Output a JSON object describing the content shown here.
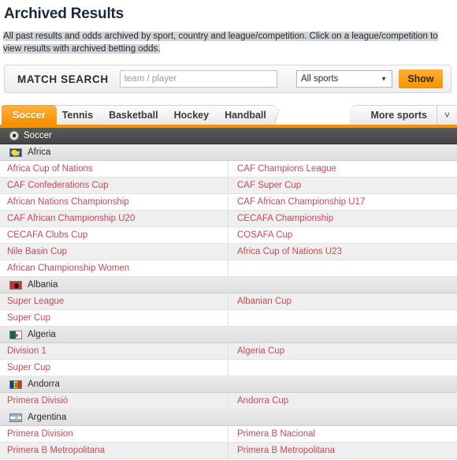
{
  "page": {
    "title": "Archived Results",
    "description": "All past results and odds archived by sport, country and league/competition. Click on a league/competition to view results with archived betting odds."
  },
  "search": {
    "label": "MATCH SEARCH",
    "input_value": "",
    "input_placeholder": "team / player",
    "sport_selected": "All sports",
    "show_label": "Show"
  },
  "tabs": {
    "items": [
      {
        "label": "Soccer",
        "active": true
      },
      {
        "label": "Tennis",
        "active": false
      },
      {
        "label": "Basketball",
        "active": false
      },
      {
        "label": "Hockey",
        "active": false
      },
      {
        "label": "Handball",
        "active": false
      }
    ],
    "more_label": "More sports",
    "more_caret": "⌄"
  },
  "sport_header": {
    "label": "Soccer"
  },
  "countries": [
    {
      "name": "Africa",
      "flag": "flag-africa",
      "leagues": [
        [
          "Africa Cup of Nations",
          "CAF Champions League"
        ],
        [
          "CAF Confederations Cup",
          "CAF Super Cup"
        ],
        [
          "African Nations Championship",
          "CAF African Championship U17"
        ],
        [
          "CAF African Championship U20",
          "CECAFA Championship"
        ],
        [
          "CECAFA Clubs Cup",
          "COSAFA Cup"
        ],
        [
          "Nile Basin Cup",
          "Africa Cup of Nations U23"
        ],
        [
          "African Championship Women",
          ""
        ]
      ]
    },
    {
      "name": "Albania",
      "flag": "flag-albania",
      "leagues": [
        [
          "Super League",
          "Albanian Cup"
        ],
        [
          "Super Cup",
          ""
        ]
      ]
    },
    {
      "name": "Algeria",
      "flag": "flag-algeria",
      "leagues": [
        [
          "Division 1",
          "Algeria Cup"
        ],
        [
          "Super Cup",
          ""
        ]
      ]
    },
    {
      "name": "Andorra",
      "flag": "flag-andorra",
      "leagues": [
        [
          "Primera Divisió",
          "Andorra Cup"
        ]
      ]
    },
    {
      "name": "Argentina",
      "flag": "flag-argentina",
      "leagues": [
        [
          "Primera Division",
          "Primera B Nacional"
        ],
        [
          "Primera B Metropolitana",
          "Primera B Metropolitana"
        ]
      ]
    }
  ],
  "colors": {
    "accent_orange": "#f79100",
    "link_red": "#c94a56",
    "header_dark": "#4a4a4a",
    "country_row": "#e4e4e4"
  }
}
